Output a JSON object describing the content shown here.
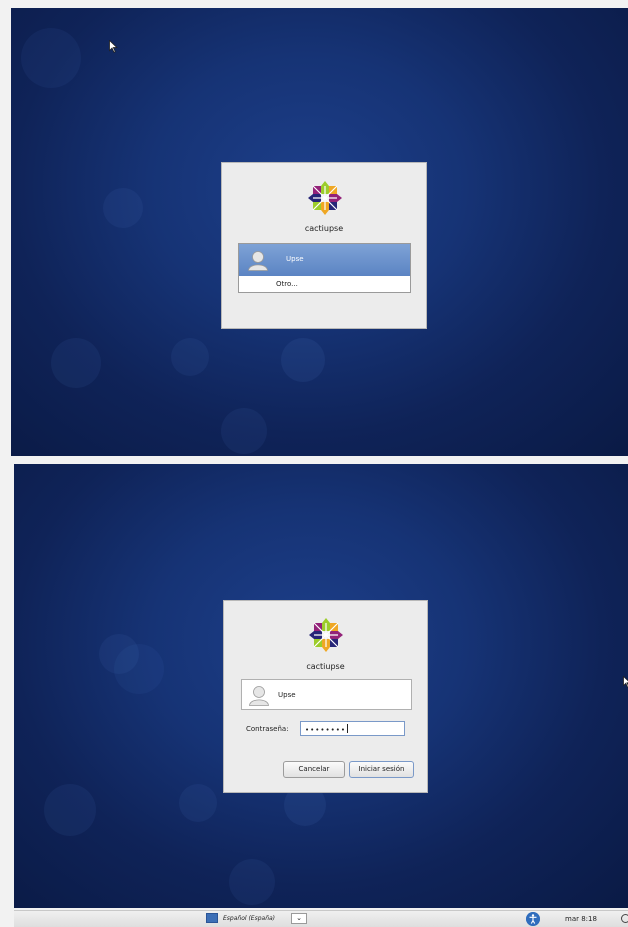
{
  "top_screen": {
    "hostname": "cactiupse",
    "users": [
      {
        "name": "Upse",
        "selected": true
      },
      {
        "name": "Otro...",
        "selected": false
      }
    ]
  },
  "bottom_screen": {
    "hostname": "cactiupse",
    "user_name": "Upse",
    "password_label": "Contraseña:",
    "password_value": "••••••••",
    "cancel_label": "Cancelar",
    "login_label": "Iniciar sesión"
  },
  "taskbar": {
    "keyboard_layout": "Español (España)",
    "clock": "mar 8:18"
  },
  "colors": {
    "desktop_background": "#163375",
    "selection": "#5b84c3",
    "dialog_background": "#ececec"
  },
  "icons": {
    "logo": "centos-logo",
    "avatar": "user-avatar-icon",
    "cursor": "mouse-pointer-icon",
    "keyboard": "keyboard-flag-icon",
    "accessibility": "accessibility-icon",
    "power": "power-icon"
  }
}
